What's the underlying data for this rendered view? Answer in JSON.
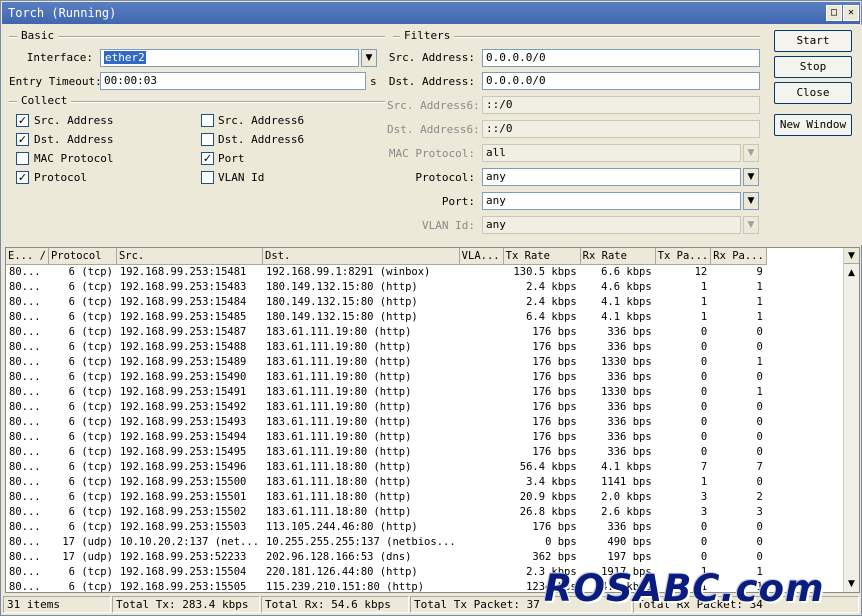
{
  "window": {
    "title": "Torch (Running)",
    "restore_label": "□",
    "close_label": "✕"
  },
  "basic": {
    "title": "Basic",
    "interface_label": "Interface:",
    "interface_value": "ether2",
    "entry_timeout_label": "Entry Timeout:",
    "entry_timeout_value": "00:00:03",
    "entry_timeout_unit": "s"
  },
  "collect": {
    "title": "Collect",
    "items": [
      {
        "label": "Src. Address",
        "checked": true
      },
      {
        "label": "Src. Address6",
        "checked": false
      },
      {
        "label": "Dst. Address",
        "checked": true
      },
      {
        "label": "Dst. Address6",
        "checked": false
      },
      {
        "label": "MAC Protocol",
        "checked": false
      },
      {
        "label": "Port",
        "checked": true
      },
      {
        "label": "Protocol",
        "checked": true
      },
      {
        "label": "VLAN Id",
        "checked": false
      }
    ]
  },
  "filters": {
    "title": "Filters",
    "src_address_label": "Src. Address:",
    "src_address_value": "0.0.0.0/0",
    "dst_address_label": "Dst. Address:",
    "dst_address_value": "0.0.0.0/0",
    "src_address6_label": "Src. Address6:",
    "src_address6_value": "::/0",
    "dst_address6_label": "Dst. Address6:",
    "dst_address6_value": "::/0",
    "mac_protocol_label": "MAC Protocol:",
    "mac_protocol_value": "all",
    "protocol_label": "Protocol:",
    "protocol_value": "any",
    "port_label": "Port:",
    "port_value": "any",
    "vlan_id_label": "VLAN Id:",
    "vlan_id_value": "any"
  },
  "buttons": {
    "start": "Start",
    "stop": "Stop",
    "close": "Close",
    "new_window": "New Window"
  },
  "table": {
    "columns": [
      "E... /",
      "Protocol",
      "Src.",
      "Dst.",
      "VLA...",
      "Tx Rate",
      "Rx Rate",
      "Tx Pa...",
      "Rx Pa..."
    ],
    "rows": [
      [
        "80...",
        "6 (tcp)",
        "192.168.99.253:15481",
        "192.168.99.1:8291 (winbox)",
        "",
        "130.5 kbps",
        "6.6 kbps",
        "12",
        "9"
      ],
      [
        "80...",
        "6 (tcp)",
        "192.168.99.253:15483",
        "180.149.132.15:80 (http)",
        "",
        "2.4 kbps",
        "4.6 kbps",
        "1",
        "1"
      ],
      [
        "80...",
        "6 (tcp)",
        "192.168.99.253:15484",
        "180.149.132.15:80 (http)",
        "",
        "2.4 kbps",
        "4.1 kbps",
        "1",
        "1"
      ],
      [
        "80...",
        "6 (tcp)",
        "192.168.99.253:15485",
        "180.149.132.15:80 (http)",
        "",
        "6.4 kbps",
        "4.1 kbps",
        "1",
        "1"
      ],
      [
        "80...",
        "6 (tcp)",
        "192.168.99.253:15487",
        "183.61.111.19:80 (http)",
        "",
        "176 bps",
        "336 bps",
        "0",
        "0"
      ],
      [
        "80...",
        "6 (tcp)",
        "192.168.99.253:15488",
        "183.61.111.19:80 (http)",
        "",
        "176 bps",
        "336 bps",
        "0",
        "0"
      ],
      [
        "80...",
        "6 (tcp)",
        "192.168.99.253:15489",
        "183.61.111.19:80 (http)",
        "",
        "176 bps",
        "1330 bps",
        "0",
        "1"
      ],
      [
        "80...",
        "6 (tcp)",
        "192.168.99.253:15490",
        "183.61.111.19:80 (http)",
        "",
        "176 bps",
        "336 bps",
        "0",
        "0"
      ],
      [
        "80...",
        "6 (tcp)",
        "192.168.99.253:15491",
        "183.61.111.19:80 (http)",
        "",
        "176 bps",
        "1330 bps",
        "0",
        "1"
      ],
      [
        "80...",
        "6 (tcp)",
        "192.168.99.253:15492",
        "183.61.111.19:80 (http)",
        "",
        "176 bps",
        "336 bps",
        "0",
        "0"
      ],
      [
        "80...",
        "6 (tcp)",
        "192.168.99.253:15493",
        "183.61.111.19:80 (http)",
        "",
        "176 bps",
        "336 bps",
        "0",
        "0"
      ],
      [
        "80...",
        "6 (tcp)",
        "192.168.99.253:15494",
        "183.61.111.19:80 (http)",
        "",
        "176 bps",
        "336 bps",
        "0",
        "0"
      ],
      [
        "80...",
        "6 (tcp)",
        "192.168.99.253:15495",
        "183.61.111.19:80 (http)",
        "",
        "176 bps",
        "336 bps",
        "0",
        "0"
      ],
      [
        "80...",
        "6 (tcp)",
        "192.168.99.253:15496",
        "183.61.111.18:80 (http)",
        "",
        "56.4 kbps",
        "4.1 kbps",
        "7",
        "7"
      ],
      [
        "80...",
        "6 (tcp)",
        "192.168.99.253:15500",
        "183.61.111.18:80 (http)",
        "",
        "3.4 kbps",
        "1141 bps",
        "1",
        "0"
      ],
      [
        "80...",
        "6 (tcp)",
        "192.168.99.253:15501",
        "183.61.111.18:80 (http)",
        "",
        "20.9 kbps",
        "2.0 kbps",
        "3",
        "2"
      ],
      [
        "80...",
        "6 (tcp)",
        "192.168.99.253:15502",
        "183.61.111.18:80 (http)",
        "",
        "26.8 kbps",
        "2.6 kbps",
        "3",
        "3"
      ],
      [
        "80...",
        "6 (tcp)",
        "192.168.99.253:15503",
        "113.105.244.46:80 (http)",
        "",
        "176 bps",
        "336 bps",
        "0",
        "0"
      ],
      [
        "80...",
        "17 (udp)",
        "10.10.20.2:137 (net...",
        "10.255.255.255:137 (netbios...",
        "",
        "0 bps",
        "490 bps",
        "0",
        "0"
      ],
      [
        "80...",
        "17 (udp)",
        "192.168.99.253:52233",
        "202.96.128.166:53 (dns)",
        "",
        "362 bps",
        "197 bps",
        "0",
        "0"
      ],
      [
        "80...",
        "6 (tcp)",
        "192.168.99.253:15504",
        "220.181.126.44:80 (http)",
        "",
        "2.3 kbps",
        "1917 bps",
        "1",
        "1"
      ],
      [
        "80...",
        "6 (tcp)",
        "192.168.99.253:15505",
        "115.239.210.151:80 (http)",
        "",
        "1234 bps",
        "4.5 kbps",
        "1",
        "1"
      ]
    ]
  },
  "status": {
    "items": "31 items",
    "total_tx": "Total Tx: 283.4 kbps",
    "total_rx": "Total Rx: 54.6 kbps",
    "total_tx_packet": "Total Tx Packet: 37",
    "total_rx_packet": "Total Rx Packet: 34"
  },
  "watermark": "ROSABC.com"
}
